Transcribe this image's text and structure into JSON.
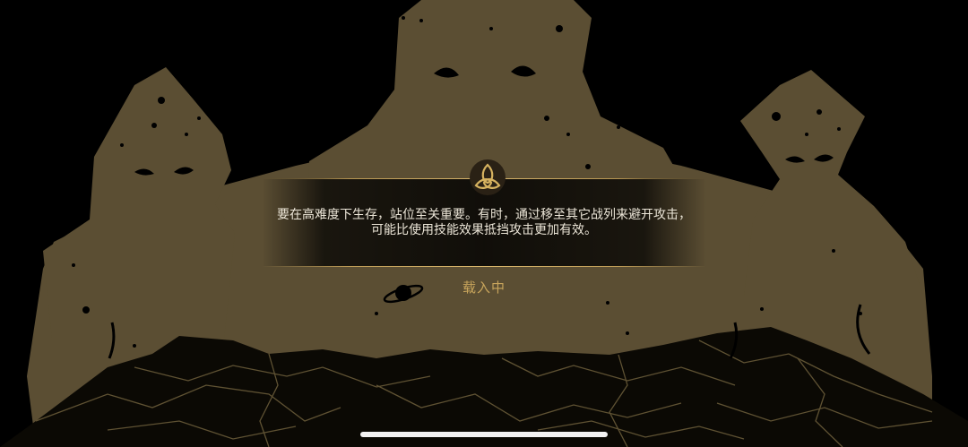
{
  "loading_screen": {
    "tip_text": "要在高难度下生存，站位至关重要。有时，通过移至其它战列来避开攻击，可能比使用技能效果抵挡攻击更加有效。",
    "loading_label": "载入中"
  },
  "icons": {
    "emblem": "triquetra-icon",
    "planet": "ringed-planet-icon"
  },
  "colors": {
    "silhouette": "#5b4e33",
    "gold_accent": "#c8a55c",
    "background": "#000000",
    "tip_text": "#ece6d8"
  }
}
